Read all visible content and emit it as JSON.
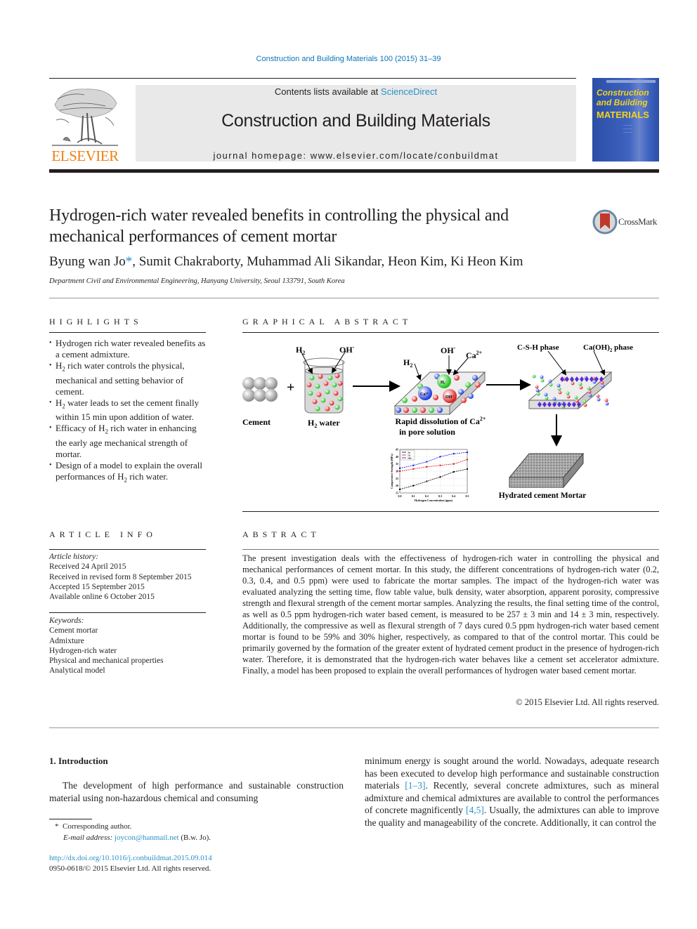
{
  "header": {
    "citation": "Construction and Building Materials 100 (2015) 31–39",
    "contents_prefix": "Contents lists available at ",
    "contents_link": "ScienceDirect",
    "journal_title": "Construction and Building Materials",
    "homepage": "journal homepage: www.elsevier.com/locate/conbuildmat",
    "publisher": "ELSEVIER",
    "cover": {
      "line1": "Construction",
      "line2": "and Building",
      "line3": "MATERIALS"
    }
  },
  "article": {
    "title": "Hydrogen-rich water revealed benefits in controlling the physical and mechanical performances of cement mortar",
    "crossmark": "CrossMark",
    "authors_first": "Byung wan Jo",
    "authors_star": "*",
    "authors_rest": ", Sumit Chakraborty, Muhammad Ali Sikandar, Heon Kim, Ki Heon Kim",
    "affiliation": "Department Civil and Environmental Engineering, Hanyang University, Seoul 133791, South Korea"
  },
  "highlights": {
    "heading": "HIGHLIGHTS",
    "items": [
      [
        "Hydrogen rich water revealed benefits as a cement admixture."
      ],
      [
        "H",
        "2",
        " rich water controls the physical, mechanical and setting behavior of cement."
      ],
      [
        "H",
        "2",
        " water leads to set the cement finally within 15 min upon addition of water."
      ],
      [
        "Efficacy of H",
        "2",
        " rich water in enhancing the early age mechanical strength of mortar."
      ],
      [
        "Design of a model to explain the overall performances of H",
        "2",
        " rich water."
      ]
    ]
  },
  "graphical_abstract": {
    "heading": "GRAPHICAL ABSTRACT",
    "labels": {
      "cement": "Cement",
      "h2_water": "H",
      "h2_water_sub": "2",
      "h2_water_suffix": " water",
      "h2": "H",
      "h2_sub": "2",
      "oh": "OH",
      "oh_sup": "-",
      "ca": "Ca",
      "ca_sup": "2+",
      "dissolution_1": "Rapid dissolution of Ca",
      "dissolution_1_sup": "2+",
      "dissolution_2": "in pore solution",
      "csh": "C-S-H phase",
      "caoh": "Ca(OH)",
      "caoh_sub": "2",
      "caoh_suffix": " phase",
      "mortar": "Hydrated cement Mortar",
      "plus": "+"
    }
  },
  "chart_data": {
    "type": "line",
    "title": "",
    "xlabel": "Hydrogen Concentration (ppm)",
    "ylabel": "Compressive Strength (MPa)",
    "x": [
      0.0,
      0.1,
      0.2,
      0.3,
      0.4,
      0.5
    ],
    "xticks": [
      "0.0",
      "0.1",
      "0.2",
      "0.3",
      "0.4",
      "0.5"
    ],
    "yticks": [
      "15",
      "20",
      "25",
      "30",
      "35",
      "40",
      "45"
    ],
    "xlim": [
      0.0,
      0.5
    ],
    "ylim": [
      15,
      45
    ],
    "grid": true,
    "legend": "top-left",
    "series": [
      {
        "name": "3d",
        "color": "#000000",
        "values": [
          17.5,
          20,
          23,
          26,
          29.5,
          31.5
        ]
      },
      {
        "name": "7d",
        "color": "#e01010",
        "values": [
          30,
          31.5,
          33,
          34,
          35,
          38
        ]
      },
      {
        "name": "28d",
        "color": "#1010e0",
        "values": [
          32,
          34,
          36.5,
          40,
          42,
          43
        ]
      }
    ]
  },
  "article_info": {
    "heading": "ARTICLE INFO",
    "history_label": "Article history:",
    "history": [
      "Received 24 April 2015",
      "Received in revised form 8 September 2015",
      "Accepted 15 September 2015",
      "Available online 6 October 2015"
    ],
    "keywords_label": "Keywords:",
    "keywords": [
      "Cement mortar",
      "Admixture",
      "Hydrogen-rich water",
      "Physical and mechanical properties",
      "Analytical model"
    ]
  },
  "abstract": {
    "heading": "ABSTRACT",
    "text": "The present investigation deals with the effectiveness of hydrogen-rich water in controlling the physical and mechanical performances of cement mortar. In this study, the different concentrations of hydrogen-rich water (0.2, 0.3, 0.4, and 0.5 ppm) were used to fabricate the mortar samples. The impact of the hydrogen-rich water was evaluated analyzing the setting time, flow table value, bulk density, water absorption, apparent porosity, compressive strength and flexural strength of the cement mortar samples. Analyzing the results, the final setting time of the control, as well as 0.5 ppm hydrogen-rich water based cement, is measured to be 257 ± 3 min and 14 ± 3 min, respectively. Additionally, the compressive as well as flexural strength of 7 days cured 0.5 ppm hydrogen-rich water based cement mortar is found to be 59% and 30% higher, respectively, as compared to that of the control mortar. This could be primarily governed by the formation of the greater extent of hydrated cement product in the presence of hydrogen-rich water. Therefore, it is demonstrated that the hydrogen-rich water behaves like a cement set accelerator admixture. Finally, a model has been proposed to explain the overall performances of hydrogen water based cement mortar.",
    "copyright": "© 2015 Elsevier Ltd. All rights reserved."
  },
  "introduction": {
    "heading": "1. Introduction",
    "left_text": "The development of high performance and sustainable construction material using non-hazardous chemical and consuming",
    "right_p1": "minimum energy is sought around the world. Nowadays, adequate research has been executed to develop high performance and sustainable construction materials ",
    "ref1": "[1–3]",
    "right_p2": ". Recently, several concrete admixtures, such as mineral admixture and chemical admixtures are available to control the performances of concrete magnificently ",
    "ref2": "[4,5]",
    "right_p3": ". Usually, the admixtures can able to improve the quality and manageability of the concrete. Additionally, it can control the"
  },
  "footnote": {
    "star": "*",
    "corresponding": "Corresponding author.",
    "email_label": "E-mail address: ",
    "email": "joycon@hanmail.net",
    "email_suffix": " (B.w. Jo).",
    "doi": "http://dx.doi.org/10.1016/j.conbuildmat.2015.09.014",
    "issn": "0950-0618/© 2015 Elsevier Ltd. All rights reserved."
  },
  "colors": {
    "link": "#2a91c9",
    "elsevier_orange": "#f07f12",
    "cover_blue": "#2b4fa6",
    "cover_yellow": "#f4d31c"
  }
}
